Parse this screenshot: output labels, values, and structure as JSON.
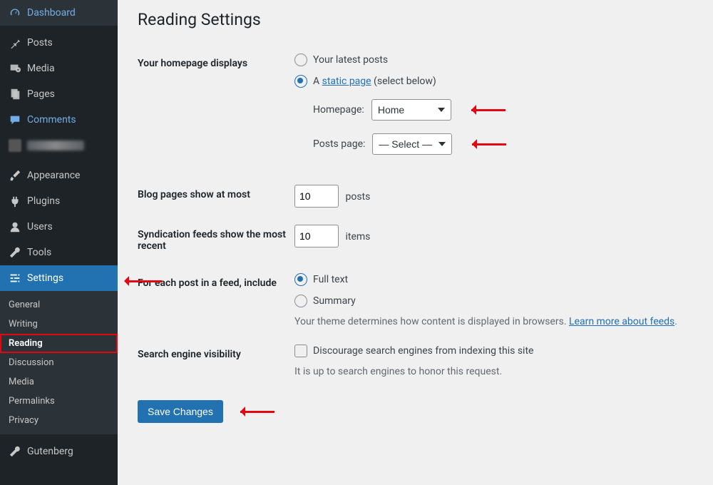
{
  "sidebar": {
    "items": [
      {
        "label": "Dashboard",
        "icon": "dashboard"
      },
      {
        "label": "Posts",
        "icon": "pin"
      },
      {
        "label": "Media",
        "icon": "media"
      },
      {
        "label": "Pages",
        "icon": "pages"
      },
      {
        "label": "Comments",
        "icon": "comment"
      },
      {
        "label": "Appearance",
        "icon": "brush"
      },
      {
        "label": "Plugins",
        "icon": "plug"
      },
      {
        "label": "Users",
        "icon": "user"
      },
      {
        "label": "Tools",
        "icon": "wrench"
      },
      {
        "label": "Settings",
        "icon": "gear"
      },
      {
        "label": "Gutenberg",
        "icon": "wrench"
      }
    ],
    "submenu": {
      "items": [
        {
          "label": "General"
        },
        {
          "label": "Writing"
        },
        {
          "label": "Reading",
          "current": true
        },
        {
          "label": "Discussion"
        },
        {
          "label": "Media"
        },
        {
          "label": "Permalinks"
        },
        {
          "label": "Privacy"
        }
      ]
    }
  },
  "page": {
    "title": "Reading Settings",
    "homepage_displays_label": "Your homepage displays",
    "radio_latest": "Your latest posts",
    "radio_static_prefix": "A ",
    "radio_static_link": "static page",
    "radio_static_suffix": " (select below)",
    "homepage_label": "Homepage:",
    "homepage_value": "Home",
    "postspage_label": "Posts page:",
    "postspage_value": "— Select —",
    "blog_pages_label": "Blog pages show at most",
    "blog_pages_value": "10",
    "blog_pages_unit": "posts",
    "syndication_label": "Syndication feeds show the most recent",
    "syndication_value": "10",
    "syndication_unit": "items",
    "feed_each_label": "For each post in a feed, include",
    "feed_full": "Full text",
    "feed_summary": "Summary",
    "feed_desc_prefix": "Your theme determines how content is displayed in browsers. ",
    "feed_desc_link": "Learn more about feeds",
    "seo_label": "Search engine visibility",
    "seo_checkbox": "Discourage search engines from indexing this site",
    "seo_desc": "It is up to search engines to honor this request.",
    "save": "Save Changes"
  }
}
